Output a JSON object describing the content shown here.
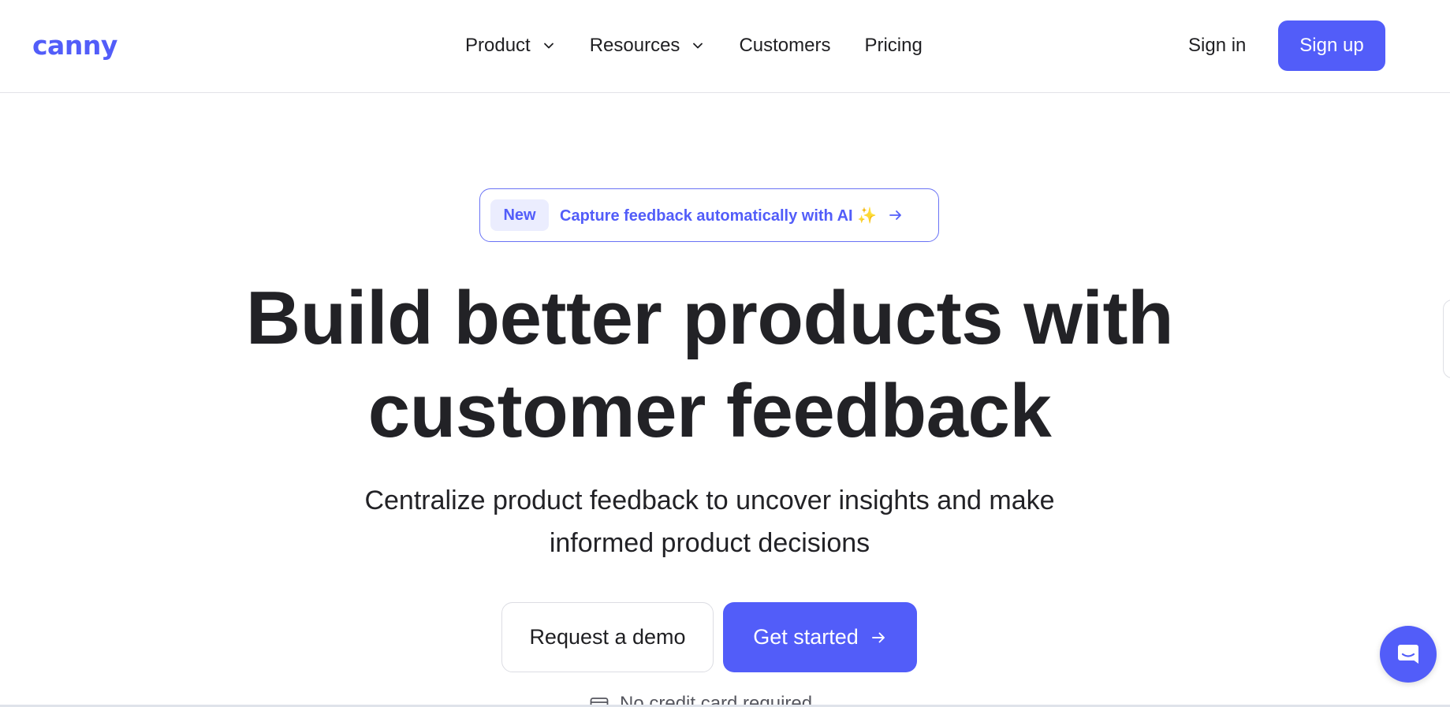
{
  "colors": {
    "brand": "#525df9",
    "text": "#1f1f22",
    "badge_bg": "#ebedfe"
  },
  "header": {
    "logo": "canny",
    "nav": [
      {
        "label": "Product",
        "has_dropdown": true
      },
      {
        "label": "Resources",
        "has_dropdown": true
      },
      {
        "label": "Customers",
        "has_dropdown": false
      },
      {
        "label": "Pricing",
        "has_dropdown": false
      }
    ],
    "sign_in": "Sign in",
    "sign_up": "Sign up"
  },
  "announcement": {
    "badge": "New",
    "text": "Capture feedback automatically with AI ✨",
    "icon": "arrow-right-icon"
  },
  "hero": {
    "headline_line1": "Build better products with",
    "headline_line2": "customer feedback",
    "subhead_line1": "Centralize product feedback to uncover insights and make",
    "subhead_line2": "informed product decisions",
    "demo_button": "Request a demo",
    "start_button": "Get started",
    "start_icon": "arrow-right-icon",
    "note": "No credit card required",
    "note_icon": "credit-card-icon"
  },
  "widgets": {
    "chat_icon": "chat-bubble-icon"
  }
}
